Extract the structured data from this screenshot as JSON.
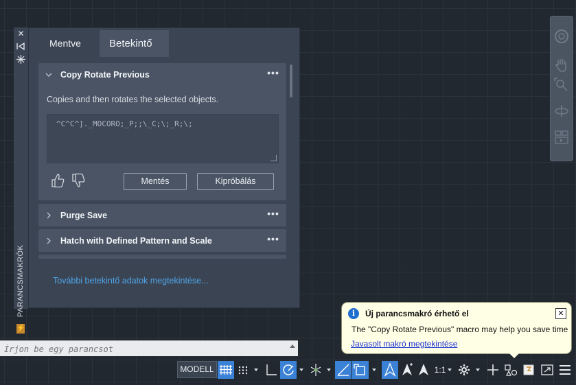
{
  "palette": {
    "vertical_title": "PARANCSMAKRÓK",
    "strip_buttons": [
      "close-icon",
      "autohide-icon",
      "properties-icon"
    ],
    "tabs": [
      {
        "label": "Mentve",
        "active": false
      },
      {
        "label": "Betekintő ...",
        "active": true
      }
    ],
    "macros": [
      {
        "title": "Copy Rotate Previous",
        "expanded": true,
        "description": "Copies and then rotates the selected objects.",
        "code": "^C^C^]._MOCORO;_P;;\\_C;\\;_R;\\;",
        "buttons": {
          "save": "Mentés",
          "try": "Kipróbálás"
        }
      },
      {
        "title": "Purge Save",
        "expanded": false
      },
      {
        "title": "Hatch with Defined Pattern and Scale",
        "expanded": false
      }
    ],
    "more_link": "További betekintő adatok megtekintése..."
  },
  "notification": {
    "title": "Új parancsmakró érhető el",
    "body": "The \"Copy Rotate Previous\" macro may help you save time",
    "link": "Javasolt makró megtekintése",
    "close": "✕"
  },
  "command_line": {
    "placeholder": "Írjon be egy parancsot"
  },
  "status_bar": {
    "model": "MODELL",
    "scale": "1:1",
    "accent": "#3b82d6"
  },
  "colors": {
    "background": "#212830",
    "palette": "#3b4453",
    "card": "#4a5464",
    "link": "#4fa6e8",
    "notification_bg": "#ffffe6"
  }
}
